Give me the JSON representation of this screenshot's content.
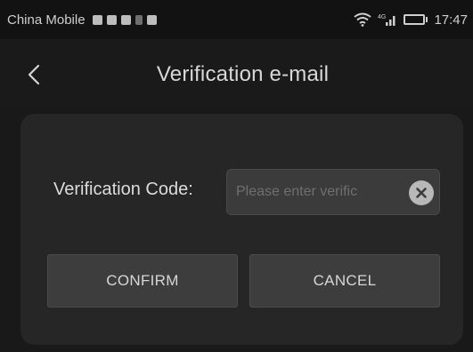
{
  "status_bar": {
    "carrier": "China Mobile",
    "network": "4G",
    "time": "17:47",
    "icons": [
      "notification-icon",
      "notification-icon",
      "notification-icon",
      "notification-icon",
      "notification-icon",
      "wifi-icon",
      "signal-icon",
      "battery-icon"
    ]
  },
  "header": {
    "title": "Verification e-mail",
    "back_icon": "chevron-left-icon"
  },
  "form": {
    "code_label": "Verification Code:",
    "code_value": "",
    "code_placeholder": "Please enter verific",
    "clear_icon": "clear-circle-icon"
  },
  "buttons": {
    "confirm_label": "CONFIRM",
    "cancel_label": "CANCEL"
  },
  "colors": {
    "background": "#191919",
    "card": "#262626",
    "button": "#3d3d3d",
    "text": "#d6d6d6"
  }
}
